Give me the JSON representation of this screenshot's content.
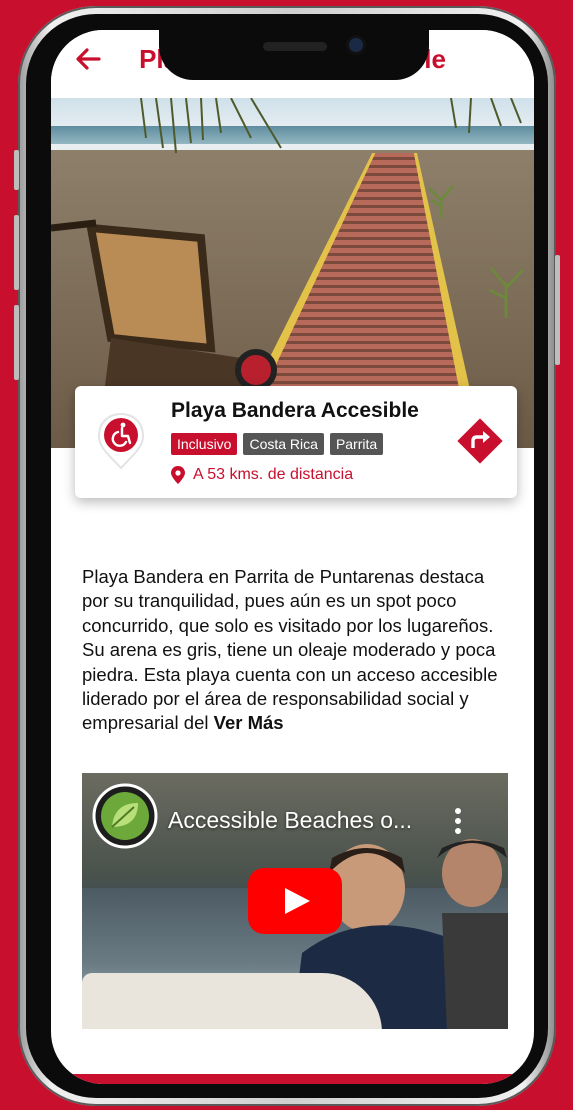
{
  "header": {
    "title": "Playa Bandera Accesible",
    "back_icon": "arrow-left-icon"
  },
  "carousel": {
    "slides": 8,
    "active_index": 0
  },
  "place": {
    "name": "Playa Bandera Accesible",
    "category_icon": "wheelchair-accessible-icon",
    "tags": [
      {
        "label": "Inclusivo",
        "style": "red"
      },
      {
        "label": "Costa Rica",
        "style": "gray"
      },
      {
        "label": "Parrita",
        "style": "gray"
      }
    ],
    "distance": "A 53 kms. de distancia",
    "distance_icon": "location-pin-icon",
    "directions_icon": "directions-icon"
  },
  "description": {
    "text": "Playa Bandera en Parrita de Puntarenas destaca por su tranquilidad, pues aún es un spot poco concurrido, que solo es visitado por los lugareños. Su arena es gris, tiene un oleaje moderado y poca piedra. Esta playa cuenta con un acceso accesible liderado por el área de responsabilidad social y empresarial del",
    "more_label": "Ver Más"
  },
  "video": {
    "title": "Accessible Beaches o...",
    "menu_icon": "more-vertical-icon",
    "play_icon": "youtube-play-icon"
  },
  "colors": {
    "brand": "#c8102e",
    "tag_gray": "#555555"
  }
}
